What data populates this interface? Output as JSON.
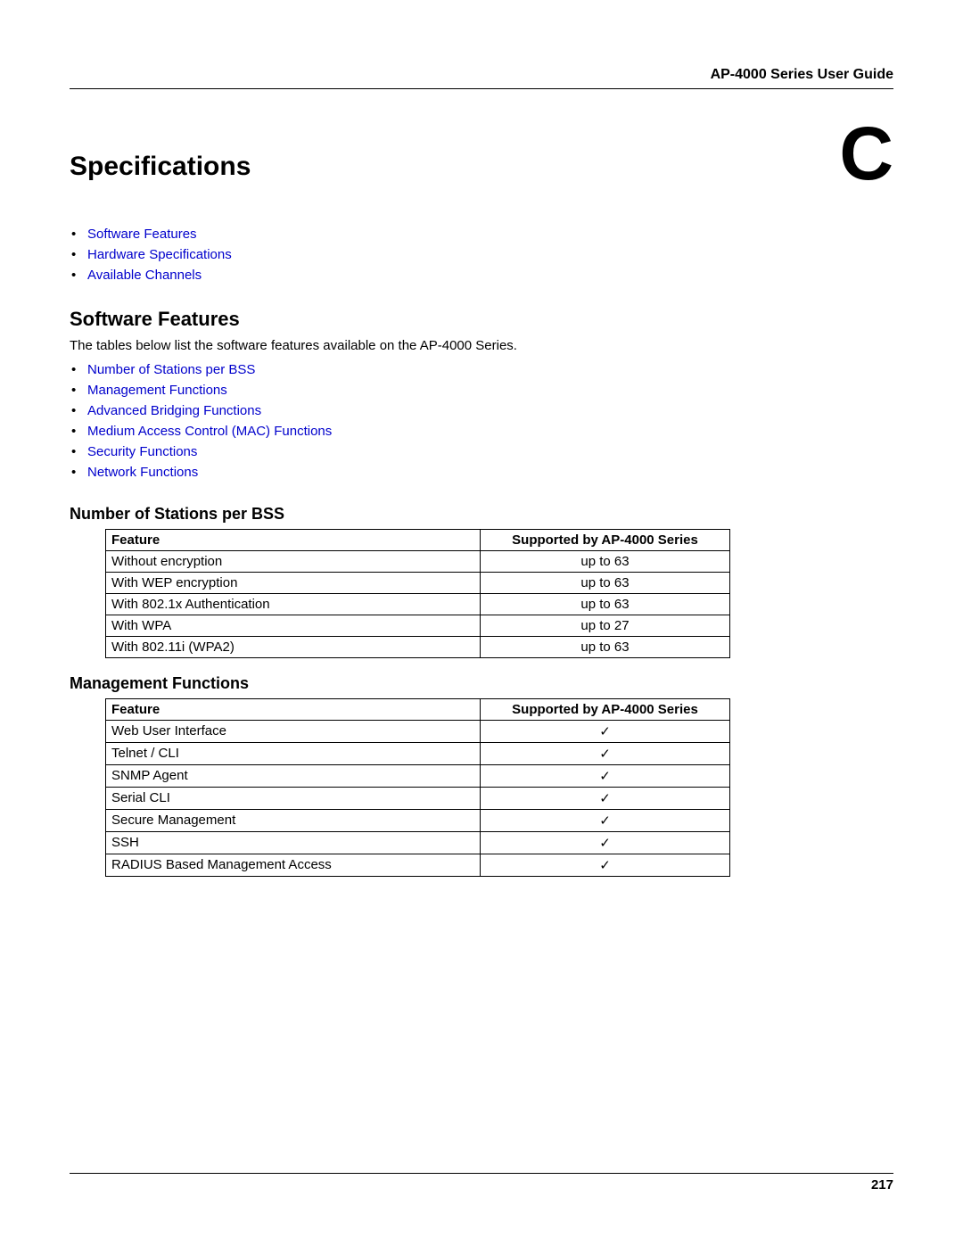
{
  "header": {
    "guide_title": "AP-4000 Series User Guide"
  },
  "main": {
    "page_title": "Specifications",
    "appendix_letter": "C",
    "top_links": [
      "Software Features",
      "Hardware Specifications",
      "Available Channels"
    ],
    "section1": {
      "heading": "Software Features",
      "intro": "The tables below list the software features available on the AP-4000 Series.",
      "links": [
        "Number of Stations per BSS",
        "Management Functions",
        "Advanced Bridging Functions",
        "Medium Access Control (MAC) Functions",
        "Security Functions",
        "Network Functions"
      ]
    },
    "table1": {
      "heading": "Number of Stations per BSS",
      "header_feature": "Feature",
      "header_support": "Supported by AP-4000 Series",
      "rows": [
        {
          "feature": "Without encryption",
          "support": "up to 63"
        },
        {
          "feature": "With WEP encryption",
          "support": "up to 63"
        },
        {
          "feature": "With 802.1x Authentication",
          "support": "up to 63"
        },
        {
          "feature": "With WPA",
          "support": "up to 27"
        },
        {
          "feature": "With 802.11i (WPA2)",
          "support": "up to 63"
        }
      ]
    },
    "table2": {
      "heading": "Management Functions",
      "header_feature": "Feature",
      "header_support": "Supported by AP-4000 Series",
      "rows": [
        {
          "feature": "Web User Interface",
          "support": "✓"
        },
        {
          "feature": "Telnet / CLI",
          "support": "✓"
        },
        {
          "feature": "SNMP Agent",
          "support": "✓"
        },
        {
          "feature": "Serial CLI",
          "support": "✓"
        },
        {
          "feature": "Secure Management",
          "support": "✓"
        },
        {
          "feature": "SSH",
          "support": "✓"
        },
        {
          "feature": "RADIUS Based Management Access",
          "support": "✓"
        }
      ]
    }
  },
  "footer": {
    "page_number": "217"
  }
}
